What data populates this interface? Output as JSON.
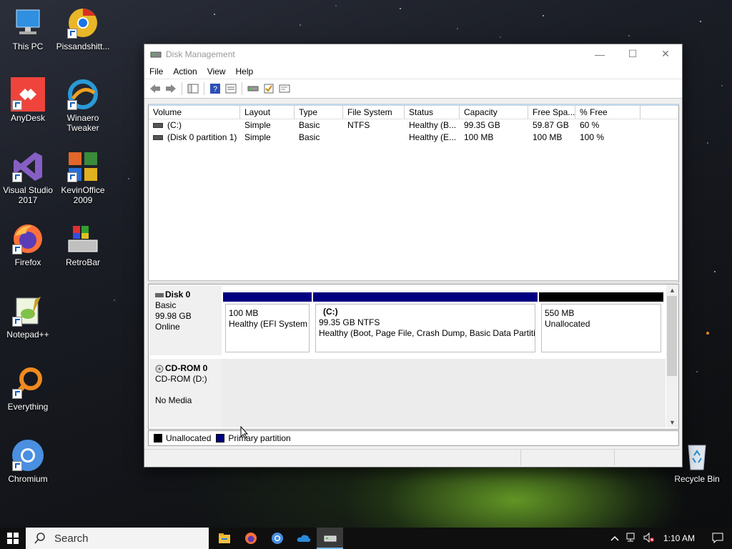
{
  "desktop": {
    "icons": [
      {
        "label": "This PC",
        "icon": "computer-icon"
      },
      {
        "label": "Pissandshitt...",
        "icon": "chrome-icon"
      },
      {
        "label": "AnyDesk",
        "icon": "anydesk-icon"
      },
      {
        "label": "Winaero Tweaker",
        "icon": "winaero-icon"
      },
      {
        "label": "Visual Studio 2017",
        "icon": "visual-studio-icon"
      },
      {
        "label": "KevinOffice 2009",
        "icon": "kevinoffice-icon"
      },
      {
        "label": "Firefox",
        "icon": "firefox-icon"
      },
      {
        "label": "RetroBar",
        "icon": "retrobar-icon"
      },
      {
        "label": "Notepad++",
        "icon": "notepadpp-icon"
      },
      {
        "label": "Everything",
        "icon": "everything-icon"
      },
      {
        "label": "Chromium",
        "icon": "chromium-icon"
      },
      {
        "label": "Recycle Bin",
        "icon": "recycle-bin-icon"
      }
    ]
  },
  "window": {
    "title": "Disk Management",
    "menu": [
      "File",
      "Action",
      "View",
      "Help"
    ],
    "volume_list": {
      "columns": [
        "Volume",
        "Layout",
        "Type",
        "File System",
        "Status",
        "Capacity",
        "Free Spa...",
        "% Free"
      ],
      "rows": [
        [
          "(C:)",
          "Simple",
          "Basic",
          "NTFS",
          "Healthy (B...",
          "99.35 GB",
          "59.87 GB",
          "60 %"
        ],
        [
          "(Disk 0 partition 1)",
          "Simple",
          "Basic",
          "",
          "Healthy (E...",
          "100 MB",
          "100 MB",
          "100 %"
        ]
      ]
    },
    "disks": [
      {
        "name": "Disk 0",
        "type": "Basic",
        "size": "99.98 GB",
        "state": "Online",
        "partitions": [
          {
            "name": "",
            "size": "100 MB",
            "status": "Healthy (EFI System Partition)",
            "kind": "primary"
          },
          {
            "name": "(C:)",
            "size": "99.35 GB NTFS",
            "status": "Healthy (Boot, Page File, Crash Dump, Basic Data Partition)",
            "kind": "primary"
          },
          {
            "name": "",
            "size": "550 MB",
            "status": "Unallocated",
            "kind": "unallocated"
          }
        ]
      },
      {
        "name": "CD-ROM 0",
        "type": "CD-ROM (D:)",
        "state": "No Media"
      }
    ],
    "legend": [
      {
        "label": "Unallocated",
        "color": "#000000"
      },
      {
        "label": "Primary partition",
        "color": "#000080"
      }
    ]
  },
  "taskbar": {
    "search_placeholder": "Search",
    "clock": "1:10 AM",
    "apps": [
      "file-explorer-icon",
      "firefox-icon",
      "chromium-icon",
      "onedrive-icon",
      "disk-management-icon"
    ]
  },
  "colors": {
    "primary_partition": "#000080",
    "unallocated": "#000000",
    "accent": "#76b9ed"
  }
}
